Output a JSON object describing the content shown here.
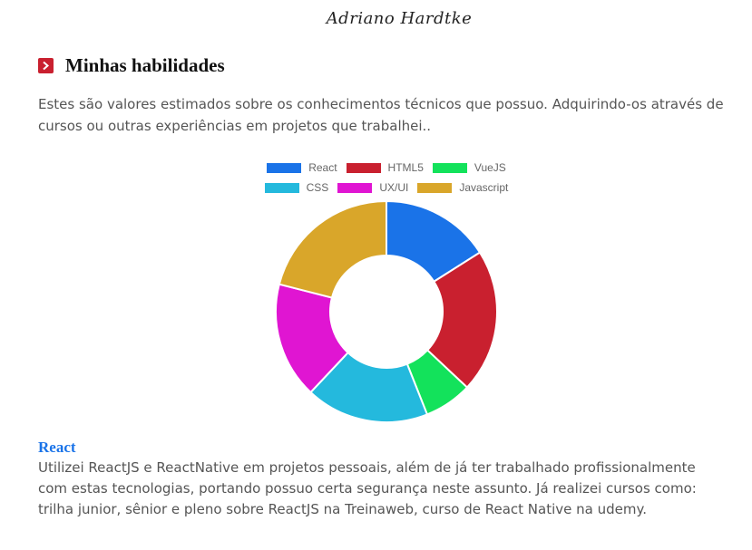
{
  "header": {
    "signature": "Adriano Hardtke"
  },
  "section": {
    "title": "Minhas habilidades",
    "intro": "Estes são valores estimados sobre os conhecimentos técnicos que possuo. Adquirindo-os através de cursos ou outras experiências em projetos que trabalhei.."
  },
  "chart_data": {
    "type": "pie",
    "variant": "doughnut",
    "categories": [
      "React",
      "HTML5",
      "VueJS",
      "CSS",
      "UX/UI",
      "Javascript"
    ],
    "values": [
      16,
      21,
      7,
      18,
      17,
      21
    ],
    "colors": [
      "#1a73e8",
      "#c9202f",
      "#13e25b",
      "#24b9dd",
      "#e015d2",
      "#d9a62a"
    ],
    "legend": "top",
    "title": ""
  },
  "skill": {
    "name": "React",
    "description": "Utilizei ReactJS e ReactNative em projetos pessoais, além de já ter trabalhado profissionalmente com estas tecnologias, portando possuo certa segurança neste assunto. Já realizei cursos como: trilha junior, sênior e pleno sobre ReactJS na Treinaweb, curso de React Native na udemy."
  }
}
